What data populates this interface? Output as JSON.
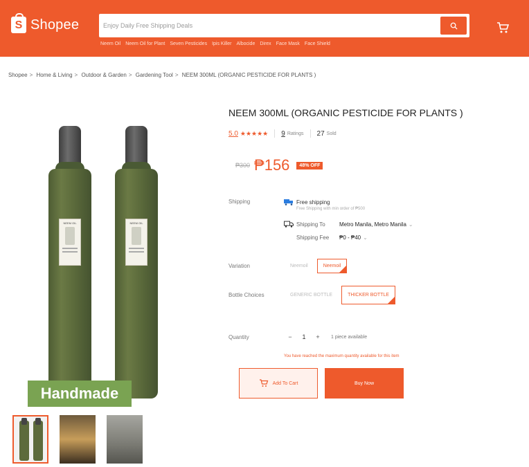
{
  "header": {
    "logo_text": "Shopee",
    "logo_letter": "S",
    "search_placeholder": "Enjoy Daily Free Shipping Deals",
    "suggestions": [
      "Neem Oil",
      "Neem Oil for Plant",
      "Seven Pesticides",
      "Ipis Killer",
      "Albocide",
      "Direx",
      "Face Mask",
      "Face Shield"
    ]
  },
  "breadcrumb": [
    "Shopee",
    "Home & Living",
    "Outdoor & Garden",
    "Gardening Tool",
    "NEEM 300ML (ORGANIC PESTICIDE FOR PLANTS )"
  ],
  "gallery": {
    "banner": "Handmade",
    "bottle_label": "NEEM OIL"
  },
  "product": {
    "title": "NEEM 300ML (ORGANIC PESTICIDE FOR PLANTS )",
    "rating": "5.0",
    "stars": "★★★★★",
    "ratings_count": "9",
    "ratings_label": "Ratings",
    "sold_count": "27",
    "sold_label": "Sold",
    "old_price": "₱300",
    "price": "₱156",
    "discount": "48% OFF"
  },
  "shipping": {
    "label": "Shipping",
    "free_title": "Free shipping",
    "free_sub": "Free Shipping with min order of ₱500",
    "to_label": "Shipping To",
    "to_value": "Metro Manila, Metro Manila",
    "fee_label": "Shipping Fee",
    "fee_value": "₱0 - ₱40"
  },
  "variation": {
    "label": "Variation",
    "options": [
      "Neemoil",
      "Neemoil"
    ]
  },
  "bottle_choices": {
    "label": "Bottle Choices",
    "options": [
      "GENERIC BOTTLE",
      "THICKER BOTTLE"
    ]
  },
  "quantity": {
    "label": "Quantity",
    "minus": "−",
    "value": "1",
    "plus": "+",
    "available": "1 piece available",
    "warning": "You have reached the maximum quantity available for this item"
  },
  "actions": {
    "add_to_cart": "Add To Cart",
    "buy_now": "Buy Now"
  },
  "colors": {
    "brand": "#ee5a2c",
    "banner_green": "#7aa352"
  }
}
